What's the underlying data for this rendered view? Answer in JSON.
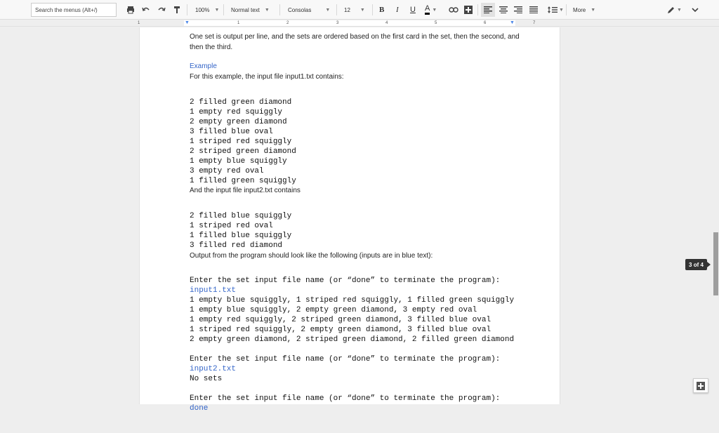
{
  "toolbar": {
    "search_placeholder": "Search the menus (Alt+/)",
    "zoom": "100%",
    "style": "Normal text",
    "font": "Consolas",
    "font_size": "12",
    "bold": "B",
    "italic": "I",
    "underline": "U",
    "text_color": "A",
    "more": "More",
    "page_indicator": "3 of 4"
  },
  "ruler": {
    "numbers": [
      "1",
      "1",
      "2",
      "3",
      "4",
      "5",
      "6",
      "7"
    ]
  },
  "doc": {
    "intro": "One set is output per line, and the sets are ordered based on the first card in the set, then the second, and then the third.",
    "example_heading": "Example",
    "example_text": "For this example, the input file input1.txt contains:",
    "input1_lines": [
      "2 filled green diamond",
      "1 empty red squiggly",
      "2 empty green diamond",
      "3 filled blue oval",
      "1 striped red squiggly",
      "2 striped green diamond",
      "1 empty blue squiggly",
      "3 empty red oval",
      "1 filled green squiggly"
    ],
    "input2_intro": "And the input file input2.txt contains",
    "input2_lines": [
      "2 filled blue squiggly",
      "1 striped red oval",
      "1 filled blue squiggly",
      "3 filled red diamond"
    ],
    "output_intro": "Output from the program should look like the following (inputs are in blue text):",
    "prompt": "Enter the set input file name (or “done” to terminate the program):",
    "input1_name": "input1.txt",
    "output1_lines": [
      "1 empty blue squiggly, 1 striped red squiggly, 1 filled green squiggly",
      "1 empty blue squiggly, 2 empty green diamond, 3 empty red oval",
      "1 empty red squiggly, 2 striped green diamond, 3 filled blue oval",
      "1 striped red squiggly, 2 empty green diamond, 3 filled blue oval",
      "2 empty green diamond, 2 striped green diamond, 2 filled green diamond"
    ],
    "input2_name": "input2.txt",
    "no_sets": "No sets",
    "done": "done"
  },
  "colors": {
    "accent_blue": "#3465c8"
  }
}
